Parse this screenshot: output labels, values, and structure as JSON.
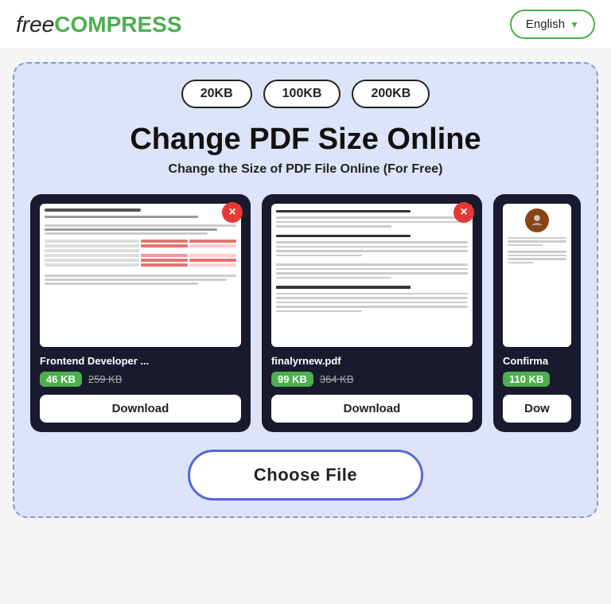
{
  "header": {
    "logo_free": "free",
    "logo_compress": "COMPRESS",
    "lang_label": "English",
    "lang_chevron": "▼"
  },
  "hero": {
    "pill_20kb": "20KB",
    "pill_100kb": "100KB",
    "pill_200kb": "200KB",
    "title": "Change PDF Size Online",
    "subtitle": "Change the Size of PDF File Online (For Free)"
  },
  "cards": [
    {
      "filename": "Frontend Developer ...",
      "size_new": "46 KB",
      "size_old": "259 KB",
      "download_label": "Download",
      "close_label": "×",
      "type": "spreadsheet"
    },
    {
      "filename": "finalyrnew.pdf",
      "size_new": "99 KB",
      "size_old": "364 KB",
      "download_label": "Download",
      "close_label": "×",
      "type": "document"
    },
    {
      "filename": "Confirma",
      "size_new": "110 KB",
      "size_old": "",
      "download_label": "Dow",
      "close_label": "",
      "type": "application"
    }
  ],
  "choose_file": {
    "label": "Choose File"
  }
}
